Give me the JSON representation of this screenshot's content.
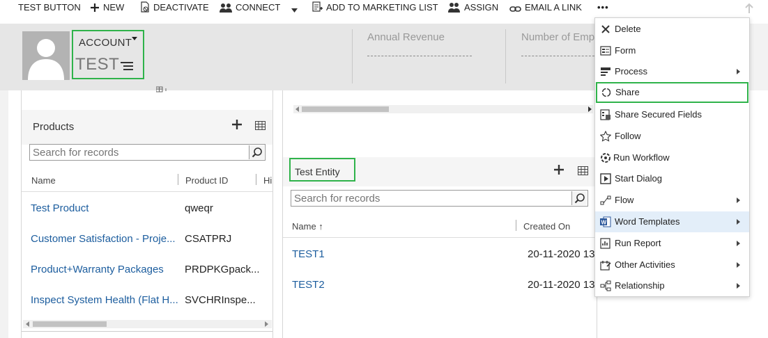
{
  "command_bar": {
    "test_button": "TEST BUTTON",
    "new": "NEW",
    "deactivate": "DEACTIVATE",
    "connect": "CONNECT",
    "add_to_marketing_list": "ADD TO MARKETING LIST",
    "assign": "ASSIGN",
    "email_a_link": "EMAIL A LINK",
    "more": "•••"
  },
  "header": {
    "entity_type": "ACCOUNT",
    "record_name": "TEST",
    "fields": [
      {
        "label": "Annual Revenue"
      },
      {
        "label": "Number of Emp"
      }
    ]
  },
  "products": {
    "title": "Products",
    "search_placeholder": "Search for records",
    "columns": [
      "Name",
      "Product ID",
      "Hi"
    ],
    "rows": [
      {
        "name": "Test Product",
        "id": "qweqr"
      },
      {
        "name": "Customer Satisfaction - Proje...",
        "id": "CSATPRJ"
      },
      {
        "name": "Product+Warranty Packages",
        "id": "PRDPKGpack..."
      },
      {
        "name": "Inspect System Health (Flat H...",
        "id": "SVCHRInspe..."
      }
    ]
  },
  "test_entity": {
    "title": "Test Entity",
    "search_placeholder": "Search for records",
    "columns": [
      "Name ↑",
      "Created On"
    ],
    "rows": [
      {
        "name": "TEST1",
        "created": "20-11-2020 13"
      },
      {
        "name": "TEST2",
        "created": "20-11-2020 13"
      }
    ]
  },
  "menu": {
    "items": [
      {
        "label": "Delete",
        "icon": "delete-icon",
        "submenu": false
      },
      {
        "label": "Form",
        "icon": "form-icon",
        "submenu": false
      },
      {
        "label": "Process",
        "icon": "process-icon",
        "submenu": true
      },
      {
        "label": "Share",
        "icon": "share-icon",
        "submenu": false
      },
      {
        "label": "Share Secured Fields",
        "icon": "share-secured-fields-icon",
        "submenu": false
      },
      {
        "label": "Follow",
        "icon": "star-icon",
        "submenu": false
      },
      {
        "label": "Run Workflow",
        "icon": "run-workflow-icon",
        "submenu": false
      },
      {
        "label": "Start Dialog",
        "icon": "start-dialog-icon",
        "submenu": false
      },
      {
        "label": "Flow",
        "icon": "flow-icon",
        "submenu": true
      },
      {
        "label": "Word Templates",
        "icon": "word-icon",
        "submenu": true
      },
      {
        "label": "Run Report",
        "icon": "report-icon",
        "submenu": true
      },
      {
        "label": "Other Activities",
        "icon": "activities-icon",
        "submenu": true
      },
      {
        "label": "Relationship",
        "icon": "relationship-icon",
        "submenu": true
      }
    ],
    "highlighted": "Word Templates",
    "outlined": "Share"
  },
  "colors": {
    "accent_green": "#2fb34a",
    "link_blue": "#1c5d9e",
    "header_gray": "#e6e6e6",
    "menu_highlight": "#e3eef9"
  }
}
